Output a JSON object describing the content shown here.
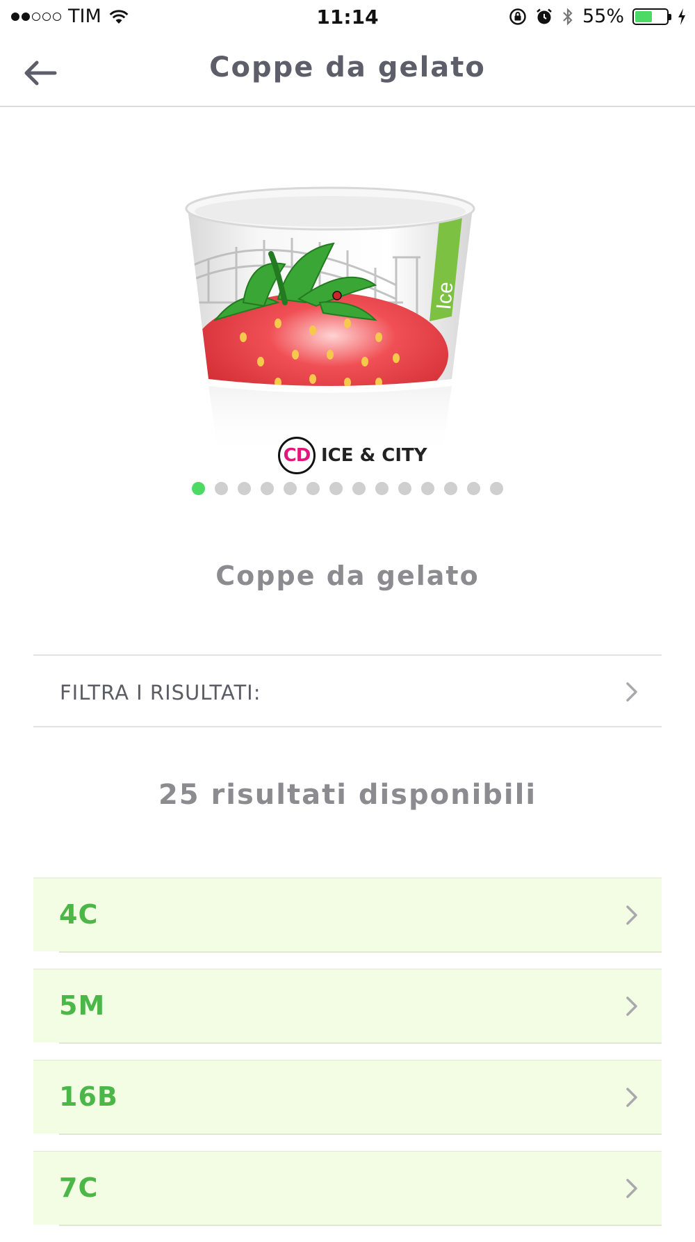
{
  "status_bar": {
    "carrier": "TIM",
    "time": "11:14",
    "battery_percent": "55%",
    "battery_level": 0.55,
    "signal_bars_filled": 2,
    "signal_bars_total": 5,
    "icons": [
      "wifi-icon",
      "orientation-lock-icon",
      "alarm-icon",
      "bluetooth-icon",
      "charging-bolt-icon"
    ]
  },
  "nav": {
    "title": "Coppe da gelato",
    "back_icon": "arrow-left-icon"
  },
  "carousel": {
    "brand_badge": "CD",
    "brand_text": "ICE & CITY",
    "cup_side_label": "Ice",
    "page_count": 14,
    "active_page": 1,
    "colors": {
      "active_dot": "#4cd964",
      "inactive_dot": "#cfcfcf",
      "strawberry": "#e03a3e",
      "band_green": "#7cc142"
    }
  },
  "product": {
    "title": "Coppe da gelato"
  },
  "filter": {
    "label": "FILTRA I RISULTATI:"
  },
  "results": {
    "count_text": "25 risultati disponibili",
    "items": [
      {
        "label": "4C"
      },
      {
        "label": "5M"
      },
      {
        "label": "16B"
      },
      {
        "label": "7C"
      }
    ]
  },
  "colors": {
    "accent_green": "#4cb749",
    "row_background": "#f3fde4",
    "title_gray": "#5e5e6a",
    "subtitle_gray": "#8b8b90"
  }
}
